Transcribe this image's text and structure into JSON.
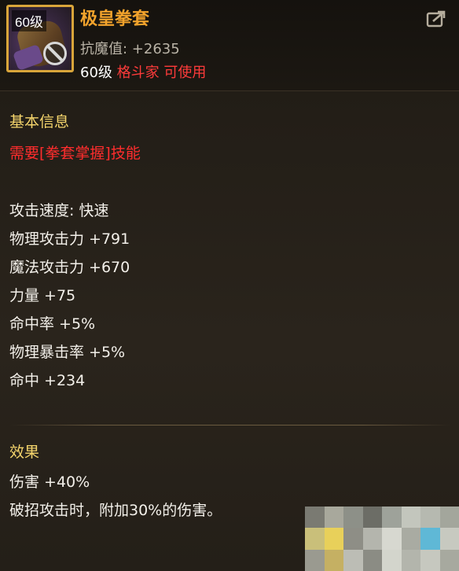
{
  "item": {
    "level_badge": "60级",
    "name": "极皇拳套",
    "magic_resist": "抗魔值: +2635",
    "req_level": "60级",
    "req_class": "格斗家",
    "req_usable": "可使用"
  },
  "basic_info": {
    "title": "基本信息",
    "skill_requirement": "需要[拳套掌握]技能",
    "stats": [
      "攻击速度: 快速",
      "物理攻击力 +791",
      "魔法攻击力 +670",
      "力量 +75",
      "命中率 +5%",
      "物理暴击率 +5%",
      "命中 +234"
    ]
  },
  "effect": {
    "title": "效果",
    "lines": [
      "伤害 +40%",
      "破招攻击时，附加30%的伤害。"
    ]
  },
  "icons": {
    "share": "share-icon",
    "no_use": "prohibited-icon"
  },
  "colors": {
    "item_name": "#f2a32c",
    "section_title": "#f5d56c",
    "warning": "#ff3b3b",
    "stat_text": "#f3f0ea",
    "icon_border": "#d9a53a"
  }
}
